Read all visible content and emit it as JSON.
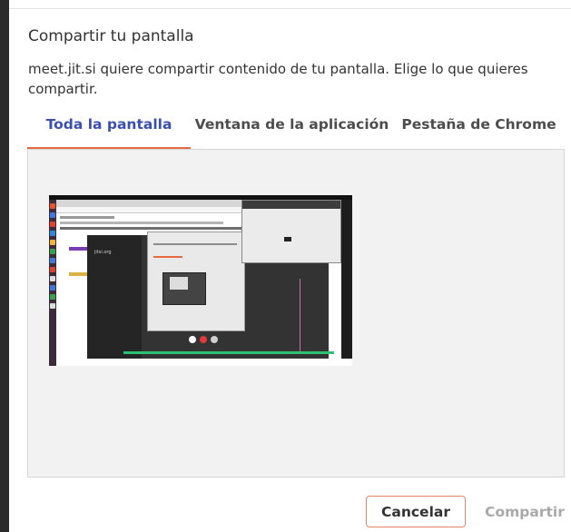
{
  "dialog": {
    "title": "Compartir tu pantalla",
    "message": "meet.jit.si quiere compartir contenido de tu pantalla. Elige lo que quieres compartir."
  },
  "tabs": [
    {
      "label": "Toda la pantalla",
      "active": true
    },
    {
      "label": "Ventana de la aplicación",
      "active": false
    },
    {
      "label": "Pestaña de Chrome",
      "active": false
    }
  ],
  "preview": {
    "thumbnail_logo": "jitsi.org"
  },
  "buttons": {
    "cancel_label": "Cancelar",
    "share_label": "Compartir",
    "share_enabled": false
  },
  "colors": {
    "accent_tab_text": "#3b4fb2",
    "accent_underline": "#e56a3f",
    "cancel_border": "#e2856a",
    "disabled_text": "#a9a9a9"
  }
}
